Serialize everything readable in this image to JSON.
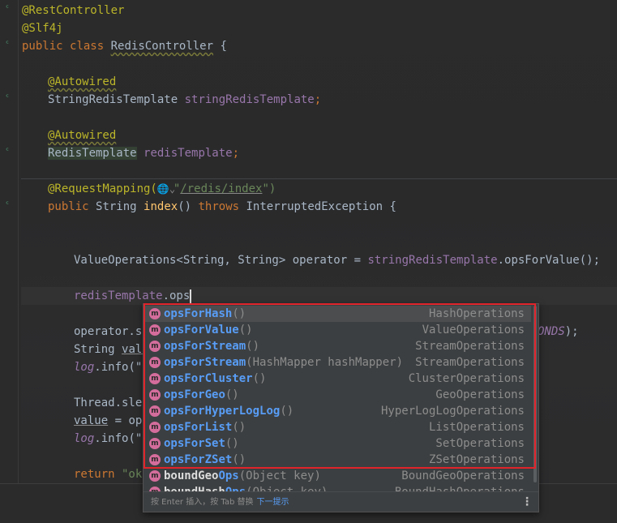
{
  "code": {
    "l1_annotation": "@RestController",
    "l2_annotation": "@Slf4j",
    "l3": {
      "kw1": "public",
      "kw2": "class",
      "class_name": "RedisController",
      "brace": " {"
    },
    "l5_annotation": "@Autowired",
    "l6": {
      "type": "StringRedisTemplate",
      "field": "stringRedisTemplate",
      "semi": ";"
    },
    "l8_annotation": "@Autowired",
    "l9": {
      "type": "RedisTemplate",
      "field": "redisTemplate",
      "semi": ";"
    },
    "l11": {
      "annotation": "@RequestMapping(",
      "globe": "🌐",
      "chev": "⌄",
      "q1": "\"",
      "path": "/redis/index",
      "q2": "\")"
    },
    "l12": {
      "kw1": "public",
      "type": "String",
      "method": "index",
      "parens": "() ",
      "kw2": "throws",
      "exc": " InterruptedException {"
    },
    "l15": {
      "a": "ValueOperations<String, String> operator = ",
      "field": "stringRedisTemplate",
      "b": ".opsForValue();"
    },
    "l17": {
      "field": "redisTemplate",
      "b": ".ops"
    },
    "l19": {
      "a": "operator.se",
      "tail_field": "ONDS",
      "tail": ");"
    },
    "l20": {
      "a": "String ",
      "var": "valu"
    },
    "l21": {
      "a": "log",
      "b": ".info(\""
    },
    "l23": {
      "a": "Thread.slee"
    },
    "l24": {
      "var": "value",
      "b": " = ope"
    },
    "l25": {
      "a": "log",
      "b": ".info(\""
    },
    "l27": {
      "kw": "return",
      "b": " \"ok\""
    }
  },
  "completion": {
    "items": [
      {
        "match": "ops",
        "rest": "ForHash",
        "params": "()",
        "return_type": "HashOperations"
      },
      {
        "match": "ops",
        "rest": "ForValue",
        "params": "()",
        "return_type": "ValueOperations"
      },
      {
        "match": "ops",
        "rest": "ForStream",
        "params": "()",
        "return_type": "StreamOperations"
      },
      {
        "match": "ops",
        "rest": "ForStream",
        "params": "(HashMapper hashMapper)",
        "return_type": "StreamOperations"
      },
      {
        "match": "ops",
        "rest": "ForCluster",
        "params": "()",
        "return_type": "ClusterOperations"
      },
      {
        "match": "ops",
        "rest": "ForGeo",
        "params": "()",
        "return_type": "GeoOperations"
      },
      {
        "match": "ops",
        "rest": "ForHyperLogLog",
        "params": "()",
        "return_type": "HyperLogLogOperations"
      },
      {
        "match": "ops",
        "rest": "ForList",
        "params": "()",
        "return_type": "ListOperations"
      },
      {
        "match": "ops",
        "rest": "ForSet",
        "params": "()",
        "return_type": "SetOperations"
      },
      {
        "match": "ops",
        "rest": "ForZSet",
        "params": "()",
        "return_type": "ZSetOperations"
      },
      {
        "pre": "boundGeo",
        "match": "Ops",
        "params": "(Object key)",
        "return_type": "BoundGeoOperations"
      },
      {
        "pre": "boundHash",
        "match": "Ops",
        "params": "(Object key)",
        "return_type": "BoundHashOperations"
      }
    ],
    "icon_letter": "m",
    "hint_text": "按 Enter 插入，按 Tab 替换",
    "hint_link": "下一提示",
    "more_icon": "⋮"
  },
  "colors": {
    "highlight_box": "#e0242b",
    "match": "#589df6",
    "method_icon": "#d46d9c"
  }
}
